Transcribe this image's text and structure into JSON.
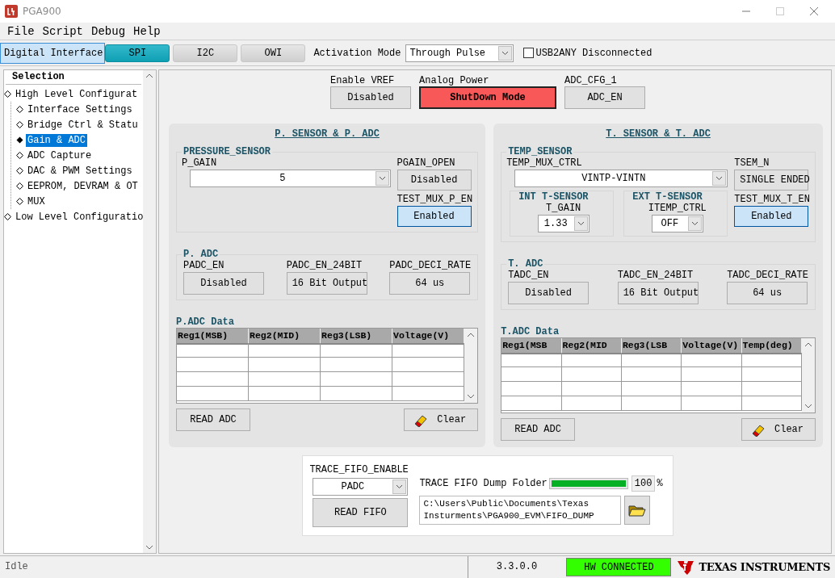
{
  "window": {
    "title": "PGA900"
  },
  "menu": [
    "File",
    "Script",
    "Debug",
    "Help"
  ],
  "toolbar": {
    "interface_label": "Digital Interface",
    "tabs": [
      {
        "label": "SPI",
        "selected": true
      },
      {
        "label": "I2C",
        "selected": false
      },
      {
        "label": "OWI",
        "selected": false
      }
    ],
    "activation_label": "Activation Mode",
    "activation_value": "Through Pulse",
    "usb": {
      "label": "USB2ANY Disconnected",
      "checked": false
    }
  },
  "sidebar": {
    "title": "Selection",
    "items": [
      {
        "label": "High Level Configurat",
        "selected": false,
        "children": [
          {
            "label": "Interface Settings",
            "selected": false
          },
          {
            "label": "Bridge Ctrl & Statu",
            "selected": false
          },
          {
            "label": "Gain & ADC",
            "selected": true
          },
          {
            "label": "ADC Capture",
            "selected": false
          },
          {
            "label": "DAC & PWM Settings",
            "selected": false
          },
          {
            "label": "EEPROM, DEVRAM & OT",
            "selected": false
          },
          {
            "label": "MUX",
            "selected": false
          }
        ]
      },
      {
        "label": "Low Level Configuratio",
        "selected": false
      }
    ]
  },
  "top_controls": [
    {
      "label": "Enable VREF",
      "value": "Disabled",
      "kind": "normal"
    },
    {
      "label": "Analog Power",
      "value": "ShutDown Mode",
      "kind": "alert"
    },
    {
      "label": "ADC_CFG_1",
      "value": "ADC_EN",
      "kind": "normal"
    }
  ],
  "panels": [
    {
      "title": "P. SENSOR & P. ADC",
      "sensor": {
        "title": "PRESSURE_SENSOR",
        "main": [
          {
            "kind": "dropdown",
            "label": "P_GAIN",
            "value": "5"
          }
        ],
        "side": [
          {
            "kind": "button",
            "label": "PGAIN_OPEN",
            "value": "Disabled",
            "on": false
          },
          {
            "kind": "button",
            "label": "TEST_MUX_P_EN",
            "value": "Enabled",
            "on": true
          }
        ]
      },
      "adc": {
        "title": "P. ADC",
        "fields": [
          {
            "label": "PADC_EN",
            "value": "Disabled",
            "on": false
          },
          {
            "label": "PADC_EN_24BIT",
            "value": "16 Bit Output",
            "on": false
          },
          {
            "label": "PADC_DECI_RATE",
            "value": "64 us",
            "on": false
          }
        ]
      },
      "data": {
        "title": "P.ADC Data",
        "columns": [
          "Reg1(MSB)",
          "Reg2(MID)",
          "Reg3(LSB)",
          "Voltage(V)"
        ]
      },
      "read_button": "READ ADC",
      "clear_button": "Clear"
    },
    {
      "title": "T. SENSOR & T. ADC",
      "sensor": {
        "title": "TEMP_SENSOR",
        "main": [
          {
            "kind": "dropdown",
            "label": "TEMP_MUX_CTRL",
            "value": "VINTP-VINTN"
          },
          {
            "kind": "group",
            "title": "INT T-SENSOR",
            "control": {
              "kind": "dropdown",
              "label": "T_GAIN",
              "value": "1.33"
            }
          },
          {
            "kind": "group",
            "title": "EXT T-SENSOR",
            "control": {
              "kind": "dropdown",
              "label": "ITEMP_CTRL",
              "value": "OFF"
            }
          }
        ],
        "side": [
          {
            "kind": "button",
            "label": "TSEM_N",
            "value": "SINGLE ENDED",
            "on": false
          },
          {
            "kind": "button",
            "label": "TEST_MUX_T_EN",
            "value": "Enabled",
            "on": true
          }
        ]
      },
      "adc": {
        "title": "T. ADC",
        "fields": [
          {
            "label": "TADC_EN",
            "value": "Disabled",
            "on": false
          },
          {
            "label": "TADC_EN_24BIT",
            "value": "16 Bit Output",
            "on": false
          },
          {
            "label": "TADC_DECI_RATE",
            "value": "64 us",
            "on": false
          }
        ]
      },
      "data": {
        "title": "T.ADC Data",
        "columns": [
          "Reg1(MSB",
          "Reg2(MID",
          "Reg3(LSB",
          "Voltage(V)",
          "Temp(deg)"
        ]
      },
      "read_button": "READ ADC",
      "clear_button": "Clear"
    }
  ],
  "fifo": {
    "enable_label": "TRACE_FIFO_ENABLE",
    "enable_value": "PADC",
    "read_button": "READ FIFO",
    "folder_label": "TRACE FIFO Dump Folder",
    "progress": {
      "level": 1,
      "reading": "100",
      "unit": "%"
    },
    "path": "C:\\Users\\Public\\Documents\\Texas Insturments\\PGA900_EVM\\FIFO_DUMP"
  },
  "status_bar": {
    "message": "Idle",
    "version": "3.3.0.0",
    "connection": {
      "label": "HW CONNECTED",
      "connected": true
    },
    "brand": "TEXAS INSTRUMENTS"
  }
}
